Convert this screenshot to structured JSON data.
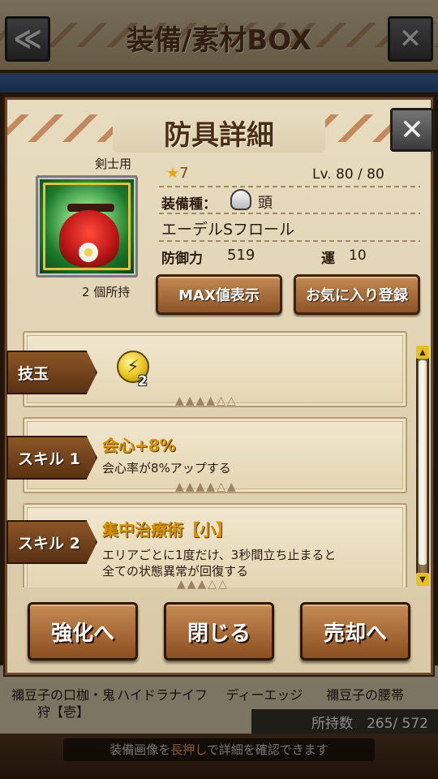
{
  "background": {
    "title": "装備/素材BOX",
    "back_symbol": "≪",
    "close_symbol": "✕",
    "items": [
      "禰豆子の口枷・鬼狩【壱】",
      "ハイドラナイフ",
      "ディーエッジ",
      "禰豆子の腰帯"
    ],
    "owned_count": "所持数　265/ 572",
    "hint_prefix": "装備画像を",
    "hint_highlight": "長押し",
    "hint_suffix": "で詳細を確認できます"
  },
  "dialog": {
    "title": "防具詳細",
    "close_symbol": "✕",
    "equipment": {
      "for_label": "剣士用",
      "owned": "2 個所持",
      "rarity_star": "★",
      "rarity": "7",
      "level": "Lv.  80 / 80",
      "type_label": "装備種：",
      "type_value": "頭",
      "name": "エーデルSフロール",
      "defense_label": "防御力",
      "defense_value": "519",
      "luck_label": "運",
      "luck_value": "10"
    },
    "buttons": {
      "max": "MAX値表示",
      "favorite": "お気に入り登録"
    },
    "gem_section": {
      "label": "技玉",
      "gem_symbol": "⚡",
      "gem_count": "2",
      "slots": "▲▲▲▲△△"
    },
    "skills": [
      {
        "label": "スキル 1",
        "name": "会心+8%",
        "desc": "会心率が8%アップする",
        "slots": "▲▲▲▲△▲"
      },
      {
        "label": "スキル 2",
        "name": "集中治療術【小】",
        "desc_line1": "エリアごとに1度だけ、3秒間立ち止まると",
        "desc_line2": "全ての状態異常が回復する",
        "slots": "▲▲▲△△"
      }
    ],
    "actions": {
      "enhance": "強化へ",
      "close": "閉じる",
      "sell": "売却へ"
    }
  }
}
